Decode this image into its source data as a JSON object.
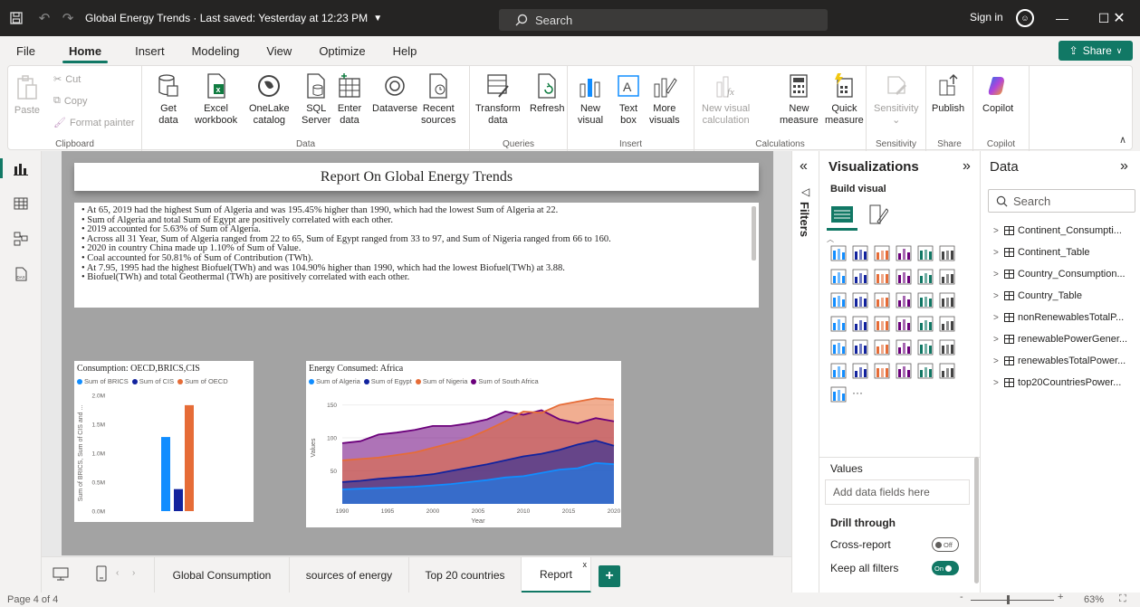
{
  "titlebar": {
    "title": "Global Energy Trends · Last saved: Yesterday at 12:23 PM",
    "search_placeholder": "Search",
    "sign_in": "Sign in"
  },
  "menu": {
    "tabs": [
      "File",
      "Home",
      "Insert",
      "Modeling",
      "View",
      "Optimize",
      "Help"
    ],
    "active": "Home",
    "share_label": "Share"
  },
  "ribbon": {
    "clipboard": {
      "label": "Clipboard",
      "paste": "Paste",
      "cut": "Cut",
      "copy": "Copy",
      "format_painter": "Format painter"
    },
    "data": {
      "label": "Data",
      "get_data_1": "Get",
      "get_data_2": "data",
      "excel_1": "Excel",
      "excel_2": "workbook",
      "onelake_1": "OneLake",
      "onelake_2": "catalog",
      "sql_1": "SQL",
      "sql_2": "Server",
      "enter_1": "Enter",
      "enter_2": "data",
      "dataverse": "Dataverse",
      "recent_1": "Recent",
      "recent_2": "sources"
    },
    "queries": {
      "label": "Queries",
      "transform_1": "Transform",
      "transform_2": "data",
      "refresh": "Refresh"
    },
    "insert": {
      "label": "Insert",
      "new_visual_1": "New",
      "new_visual_2": "visual",
      "text_box_1": "Text",
      "text_box_2": "box",
      "more_visuals_1": "More",
      "more_visuals_2": "visuals"
    },
    "calculations": {
      "label": "Calculations",
      "new_visual_calc_1": "New visual",
      "new_visual_calc_2": "calculation",
      "new_measure_1": "New",
      "new_measure_2": "measure",
      "quick_measure_1": "Quick",
      "quick_measure_2": "measure"
    },
    "sensitivity": {
      "label": "Sensitivity",
      "button": "Sensitivity"
    },
    "share": {
      "label": "Share",
      "publish": "Publish"
    },
    "copilot": {
      "label": "Copilot",
      "button": "Copilot"
    }
  },
  "report": {
    "title": "Report On Global Energy Trends",
    "narrative": [
      "• At 65, 2019 had the highest Sum of Algeria and was 195.45% higher than 1990, which had the lowest Sum of Algeria at 22.",
      "• Sum of Algeria and total Sum of Egypt are positively correlated with each other.",
      "• 2019 accounted for 5.63% of Sum of Algeria.",
      "• Across all 31 Year, Sum of Algeria ranged from 22 to 65, Sum of Egypt ranged from 33 to 97, and Sum of Nigeria ranged from 66 to 160.",
      "• 2020 in country China made up 1.10% of Sum of Value.",
      "• Coal accounted for 50.81% of Sum of Contribution (TWh).",
      "• At 7.95, 1995 had the highest  Biofuel(TWh) and was 104.90% higher than 1990, which had the lowest  Biofuel(TWh) at 3.88.",
      "•  Biofuel(TWh) and total  Geothermal (TWh) are positively correlated with each other."
    ]
  },
  "chart_data": [
    {
      "type": "bar",
      "title": "Consumption: OECD,BRICS,CIS",
      "ylabel": "Sum of BRICS, Sum of CIS and ...",
      "ylim": [
        0,
        2000000
      ],
      "yticks": [
        "0.0M",
        "0.5M",
        "1.0M",
        "1.5M",
        "2.0M"
      ],
      "series": [
        {
          "name": "Sum of BRICS",
          "color": "#118dff",
          "values": [
            1280000
          ]
        },
        {
          "name": "Sum of CIS",
          "color": "#12239e",
          "values": [
            380000
          ]
        },
        {
          "name": "Sum of OECD",
          "color": "#e66c37",
          "values": [
            1830000
          ]
        }
      ]
    },
    {
      "type": "area",
      "title": "Energy Consumed: Africa",
      "xlabel": "Year",
      "ylabel": "Values",
      "xlim": [
        1990,
        2020
      ],
      "ylim": [
        0,
        170
      ],
      "xticks": [
        "1990",
        "1995",
        "2000",
        "2005",
        "2010",
        "2015",
        "2020"
      ],
      "yticks": [
        "50",
        "100",
        "150"
      ],
      "x": [
        1990,
        1992,
        1994,
        1996,
        1998,
        2000,
        2002,
        2004,
        2006,
        2008,
        2010,
        2012,
        2014,
        2016,
        2018,
        2020
      ],
      "series": [
        {
          "name": "Sum of Algeria",
          "color": "#118dff",
          "values": [
            22,
            23,
            24,
            25,
            26,
            28,
            30,
            33,
            36,
            40,
            42,
            47,
            52,
            54,
            62,
            60
          ]
        },
        {
          "name": "Sum of Egypt",
          "color": "#12239e",
          "values": [
            33,
            35,
            38,
            40,
            42,
            45,
            50,
            55,
            60,
            66,
            72,
            76,
            82,
            90,
            96,
            88
          ]
        },
        {
          "name": "Sum of Nigeria",
          "color": "#e66c37",
          "values": [
            66,
            68,
            70,
            74,
            78,
            85,
            92,
            100,
            112,
            125,
            140,
            138,
            150,
            155,
            160,
            158
          ]
        },
        {
          "name": "Sum of South Africa",
          "color": "#6b007b",
          "values": [
            92,
            95,
            105,
            108,
            112,
            118,
            118,
            122,
            128,
            140,
            135,
            142,
            128,
            122,
            130,
            125
          ]
        }
      ]
    }
  ],
  "pages": {
    "tabs": [
      "Global Consumption",
      "sources of energy",
      "Top 20 countries",
      "Report"
    ],
    "active": "Report",
    "status": "Page 4 of 4",
    "zoom": "63%"
  },
  "filters": {
    "label": "Filters"
  },
  "viz_pane": {
    "title": "Visualizations",
    "build_visual": "Build visual",
    "values_label": "Values",
    "add_fields": "Add data fields here",
    "drill_through": "Drill through",
    "cross_report": "Cross-report",
    "cross_report_state": "Off",
    "keep_all_filters": "Keep all filters",
    "keep_all_filters_state": "On"
  },
  "data_pane": {
    "title": "Data",
    "search_placeholder": "Search",
    "tables": [
      "Continent_Consumpti...",
      "Continent_Table",
      "Country_Consumption...",
      "Country_Table",
      "nonRenewablesTotalP...",
      "renewablePowerGener...",
      "renewablesTotalPower...",
      "top20CountriesPower..."
    ]
  }
}
